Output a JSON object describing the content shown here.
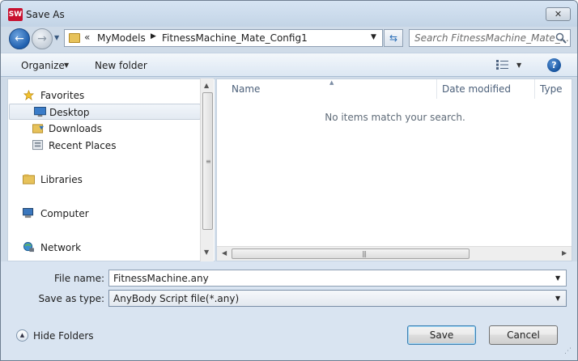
{
  "window": {
    "title": "Save As",
    "app_icon_text": "SW",
    "close_glyph": "✕"
  },
  "nav": {
    "back_glyph": "←",
    "forward_glyph": "→",
    "recent_glyph": "▼"
  },
  "address": {
    "chevron": "«",
    "crumbs": [
      "MyModels",
      "FitnessMachine_Mate_Config1"
    ],
    "separator": "▶",
    "dropdown_glyph": "▼",
    "refresh_glyph": "⇆"
  },
  "search": {
    "placeholder": "Search FitnessMachine_Mate_..."
  },
  "toolbar": {
    "organize": "Organize",
    "organize_arrow": "▼",
    "new_folder": "New folder",
    "views_arrow": "▼",
    "help": "?"
  },
  "sidebar": {
    "items": [
      {
        "label": "Favorites",
        "icon": "star-icon",
        "group": true
      },
      {
        "label": "Desktop",
        "icon": "desktop-icon",
        "selected": true
      },
      {
        "label": "Downloads",
        "icon": "downloads-icon"
      },
      {
        "label": "Recent Places",
        "icon": "recent-places-icon"
      },
      {
        "label": "Libraries",
        "icon": "libraries-icon",
        "group": true
      },
      {
        "label": "Computer",
        "icon": "computer-icon",
        "group": true
      },
      {
        "label": "Network",
        "icon": "network-icon",
        "group": true
      }
    ]
  },
  "filelist": {
    "columns": [
      "Name",
      "Date modified",
      "Type"
    ],
    "empty_message": "No items match your search.",
    "sort_glyph": "▲",
    "hscroll_grip": "|||",
    "vscroll_grip": "≡"
  },
  "form": {
    "filename_label": "File name:",
    "filename_value": "FitnessMachine.any",
    "savetype_label": "Save as type:",
    "savetype_value": "AnyBody Script file(*.any)",
    "arrow": "▼"
  },
  "footer": {
    "hide_folders": "Hide Folders",
    "hide_folders_glyph": "▲",
    "save": "Save",
    "cancel": "Cancel",
    "resize_grip": "⋰"
  },
  "colors": {
    "accent": "#1f5fae",
    "titlebar": "#c3d4e6",
    "form_bg": "#d9e4f1"
  }
}
